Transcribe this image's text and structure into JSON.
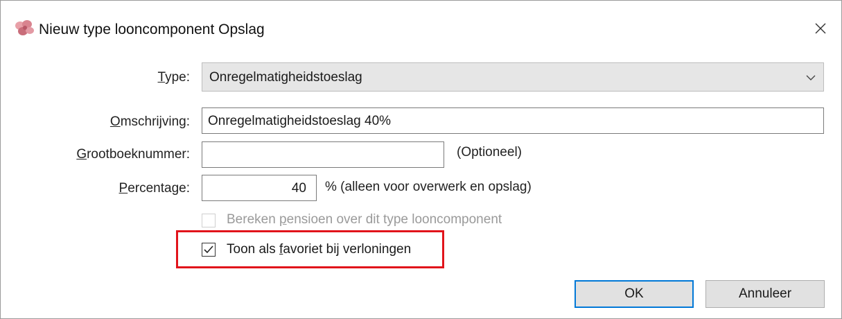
{
  "window": {
    "title": "Nieuw type looncomponent Opslag",
    "icon": "flower-app-icon",
    "close_icon": "close-icon"
  },
  "form": {
    "type": {
      "label_first": "T",
      "label_rest": "ype:",
      "value": "Onregelmatigheidstoeslag"
    },
    "omschrijving": {
      "label_first": "O",
      "label_rest": "mschrijving:",
      "value": "Onregelmatigheidstoeslag 40%"
    },
    "grootboeknummer": {
      "label_first": "G",
      "label_rest": "rootboeknummer:",
      "value": "",
      "note": "(Optioneel)"
    },
    "percentage": {
      "label_first": "P",
      "label_rest": "ercentage:",
      "value": "40",
      "note": "% (alleen voor overwerk en opslag)"
    },
    "pensioen": {
      "label_pre": "Bereken ",
      "label_ul": "p",
      "label_post": "ensioen over dit type looncomponent",
      "checked": false,
      "disabled": true
    },
    "favoriet": {
      "label_pre": "Toon als ",
      "label_ul": "f",
      "label_post": "avoriet bij verloningen",
      "checked": true,
      "highlighted": true
    }
  },
  "buttons": {
    "ok": "OK",
    "cancel": "Annuleer"
  },
  "colors": {
    "highlight": "#e1141b",
    "default_button_border": "#0078d7"
  }
}
